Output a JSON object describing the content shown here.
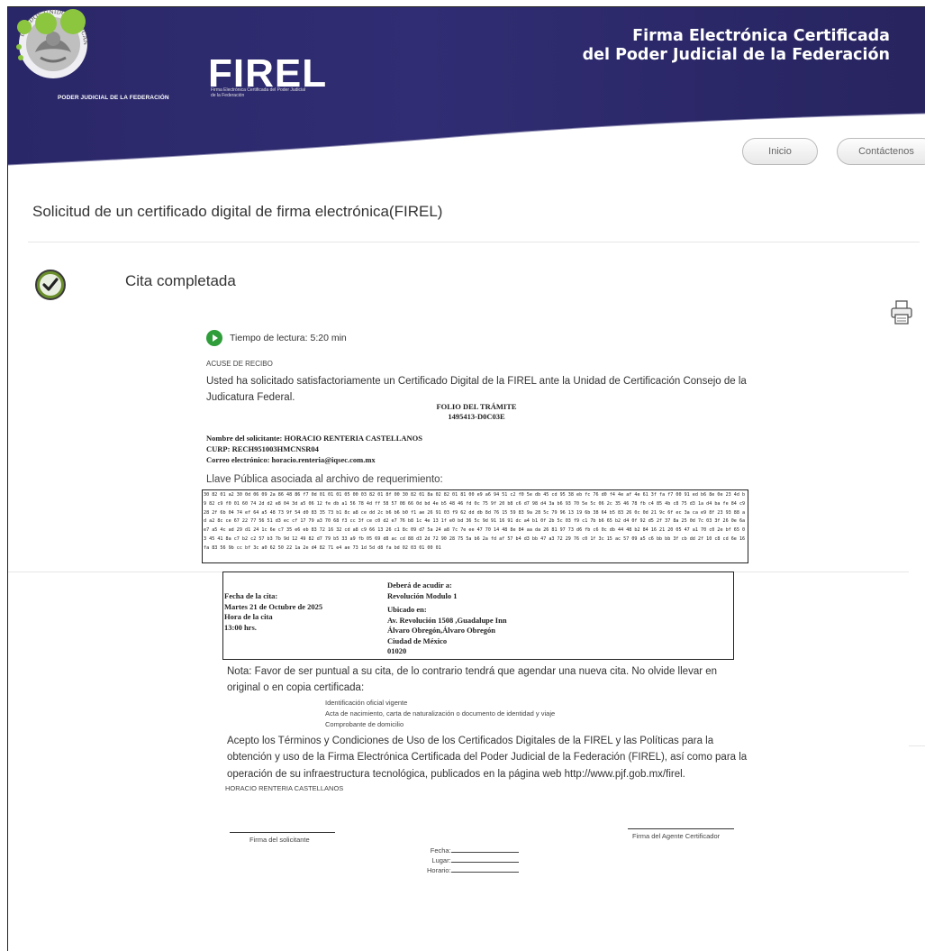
{
  "header": {
    "institution_label": "PODER JUDICIAL DE LA FEDERACIÓN",
    "seal_text": "ESTADOS UNIDOS MEXICANOS",
    "logo_word": "FIREL",
    "logo_subtitle": "Firma Electrónica Certificada del Poder Judicial de la Federación",
    "title_line1": "Firma Electrónica Certificada",
    "title_line2": "del Poder Judicial de la Federación"
  },
  "nav": {
    "home_label": "Inicio",
    "contact_label": "Contáctenos"
  },
  "page": {
    "title": "Solicitud de un certificado digital de firma electrónica(FIREL)",
    "status": "Cita completada"
  },
  "document": {
    "reading_time": "Tiempo de lectura: 5:20 min",
    "acuse_label": "ACUSE DE RECIBO",
    "intro": "Usted ha solicitado satisfactoriamente un Certificado Digital de la FIREL ante la Unidad de Certificación Consejo de la Judicatura Federal.",
    "folio_label": "FOLIO DEL TRÁMITE",
    "folio_value": "1495413-D0C03E",
    "applicant_name": "Nombre del solicitante: HORACIO RENTERIA CASTELLANOS",
    "curp": "CURP: RECH951003HMCNSR04",
    "email": "Correo electrónico: horacio.renteria@iqsec.com.mx",
    "public_key_label": "Llave Pública asociada al archivo de requerimiento:",
    "public_key": "30 82 01 a2 30 0d 06 09 2a 86 48 86 f7 0d 01 01 01 05 00 03 82 01 8f 00 30 82 01 8a 02 82 01 81 00 e9 a6 94 51 c2 f0 5e db 45 cd 95 38 eb fc 76 d0 f4 4e af 4e 61 3f fa f7 00 91 ed b6 8e 0e 23 4d b9 82 c9 f0 01 60 74 2d d2 e8 04 3d a5 06 12 fe db a1 56 78 4d ff 58 57 08 66 0d bd 4e b5 48 46 fd 0c 75 9f 20 b8 c6 d7 98 d4 3a b6 93 70 5e 5c 06 2c 35 46 78 fb c4 85 4b c8 75 d3 1a d4 ba fe 84 c9 28 2f 6b 04 74 ef 64 a5 48 73 9f 54 d0 83 35 73 b1 8c a8 ce dd 2c b6 b6 b0 f1 ae 26 91 03 f9 62 dd db 8d 76 15 59 83 9a 28 5c 79 96 13 19 6b 38 64 b5 83 26 0c 0d 21 9c 6f ec 3a ca e9 8f 23 93 88 ad a2 8c ce 67 22 77 56 51 d3 ec cf 17 79 a3 70 68 f3 cc 3f ce c0 d2 e7 76 b8 1c 4e 13 1f e0 bd 36 5c 9d 91 16 91 dc a4 b1 0f 2b 5c 03 f9 c1 7b b6 65 b2 d4 0f 92 d5 2f 37 8a 25 0d 7c 03 3f 26 0e 6a e7 a5 4c ad 29 d1 24 1c 6e c7 35 e6 eb 83 72 16 32 cd a8 c9 66 13 26 c1 8c 09 d7 5a 24 a8 7c 7e ee 47 70 14 48 8e 84 aa da 26 81 97 73 d6 fb c6 0c db 44 48 b2 84 16 21 20 05 47 a1 70 c0 2e bf 65 03 45 41 8a c7 b2 c2 57 b3 7b 9d 12 49 82 d7 79 b5 33 a9 fb 05 69 d8 ac cd 88 d3 2d 72 90 28 75 5a b6 2a fd af 57 b4 d3 bb 47 a3 72 29 76 c0 1f 3c 15 ac 57 09 a5 c6 bb bb 3f cb dd 2f 10 c8 cd 6e 16 fa 83 56 9b cc bf 3c a0 62 50 22 1a 2e d4 82 71 e4 ae 73 1d 5d d8 fa bd 02 03 01 00 01"
  },
  "appointment": {
    "date_label": "Fecha de la cita:",
    "date_value": "Martes 21 de Octubre de 2025",
    "time_label": "Hora de la cita",
    "time_value": "13:00 hrs.",
    "go_to_label": "Deberá de acudir a:",
    "go_to_value": "Revolución Modulo 1",
    "location_label": "Ubicado en:",
    "address_line1": "Av. Revolución 1508 ,Guadalupe Inn",
    "address_line2": "Álvaro Obregón,Álvaro Obregón",
    "address_line3": "Ciudad de México",
    "postal_code": "01020"
  },
  "requirements": {
    "note": "Nota: Favor de ser puntual a su cita, de lo contrario tendrá que agendar una nueva cita. No olvide llevar en original o en copia certificada:",
    "items": [
      "Identificación oficial vigente",
      "Acta de nacimiento, carta de naturalización o documento de identidad y viaje",
      "Comprobante de domicilio"
    ]
  },
  "terms": {
    "text": "Acepto los Términos y Condiciones de Uso de los Certificados Digitales de la FIREL y las Políticas para la obtención y uso de la Firma Electrónica Certificada del Poder Judicial de la Federación (FIREL), así como para la operación de su infraestructura tecnológica, publicados en la página web http://www.pjf.gob.mx/firel.",
    "signer": "HORACIO RENTERIA CASTELLANOS"
  },
  "signatures": {
    "applicant_label": "Firma del solicitante",
    "agent_label": "Firma del Agente Certificador",
    "date_label": "Fecha:",
    "place_label": "Lugar:",
    "schedule_label": "Horario:"
  },
  "colors": {
    "banner": "#2a2768",
    "logo_green": "#8cc63f",
    "check_green": "#6a8f2a",
    "play_green": "#2e9d3a"
  }
}
